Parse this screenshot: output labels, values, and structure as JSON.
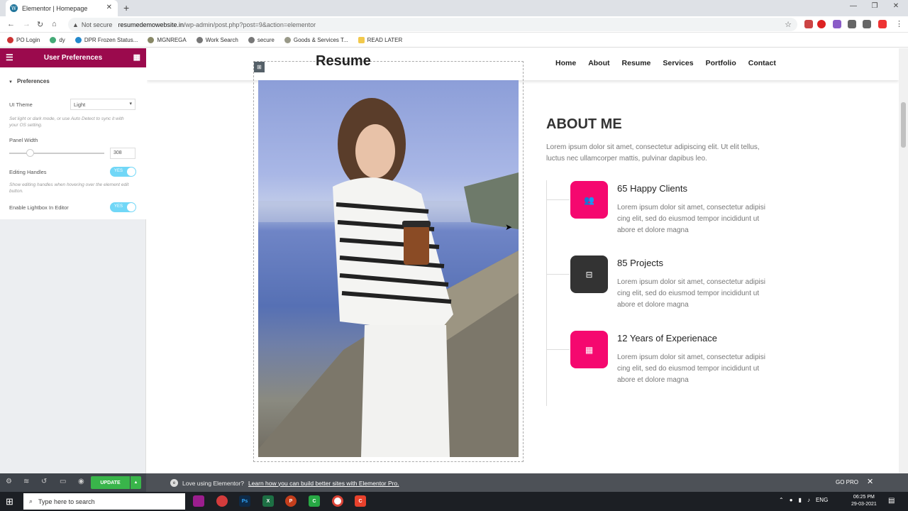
{
  "browser": {
    "tab_title": "Elementor | Homepage",
    "tab_icon": "W",
    "new_tab": "+",
    "not_secure": "Not secure",
    "url_host": "resumedemowebsite.in",
    "url_path": "/wp-admin/post.php?post=9&action=elementor",
    "bookmarks": [
      "PO Login",
      "dy",
      "DPR Frozen Status...",
      "MGNREGA",
      "Work Search",
      "secure",
      "Goods & Services T...",
      "READ LATER"
    ]
  },
  "panel": {
    "title": "User Preferences",
    "section": "Preferences",
    "ui_theme_label": "UI Theme",
    "ui_theme_value": "Light",
    "ui_theme_desc": "Set light or dark mode, or use Auto Detect to sync it with your OS setting.",
    "panel_width_label": "Panel Width",
    "panel_width_value": "308",
    "panel_width_fraction": 0.22,
    "editing_handles_label": "Editing Handles",
    "editing_handles_toggle": "YES",
    "editing_handles_desc": "Show editing handles when hovering over the element edit button.",
    "lightbox_label": "Enable Lightbox In Editor",
    "lightbox_toggle": "YES"
  },
  "bottom_bar": {
    "update_label": "UPDATE",
    "promo_text": "Love using Elementor?",
    "promo_link": "Learn how you can build better sites with Elementor Pro.",
    "go_pro": "GO PRO"
  },
  "taskbar": {
    "search_placeholder": "Type here to search",
    "language": "ENG",
    "time": "06:25 PM",
    "date": "29-03-2021"
  },
  "site": {
    "logo": "Resume",
    "menu": [
      "Home",
      "About",
      "Resume",
      "Services",
      "Portfolio",
      "Contact"
    ],
    "about_title": "ABOUT ME",
    "about_text": "Lorem ipsum dolor sit amet, consectetur adipiscing elit. Ut elit tellus, luctus nec ullamcorper mattis, pulvinar dapibus leo.",
    "stats": [
      {
        "title": "65 Happy Clients",
        "desc": "Lorem ipsum dolor sit amet, consectetur adipisi cing elit, sed do eiusmod tempor incididunt ut abore et dolore magna",
        "icon": "users-icon",
        "color": "#f5086f"
      },
      {
        "title": "85 Projects",
        "desc": "Lorem ipsum dolor sit amet, consectetur adipisi cing elit, sed do eiusmod tempor incididunt ut abore et dolore magna",
        "icon": "sitemap-icon",
        "color": "#333333"
      },
      {
        "title": "12 Years of Experienace",
        "desc": "Lorem ipsum dolor sit amet, consectetur adipisi cing elit, sed do eiusmod tempor incididunt ut abore et dolore magna",
        "icon": "calendar-icon",
        "color": "#f5086f"
      }
    ]
  },
  "colors": {
    "panel_header": "#9b0a4d",
    "accent": "#f5086f",
    "update": "#39b54a"
  }
}
